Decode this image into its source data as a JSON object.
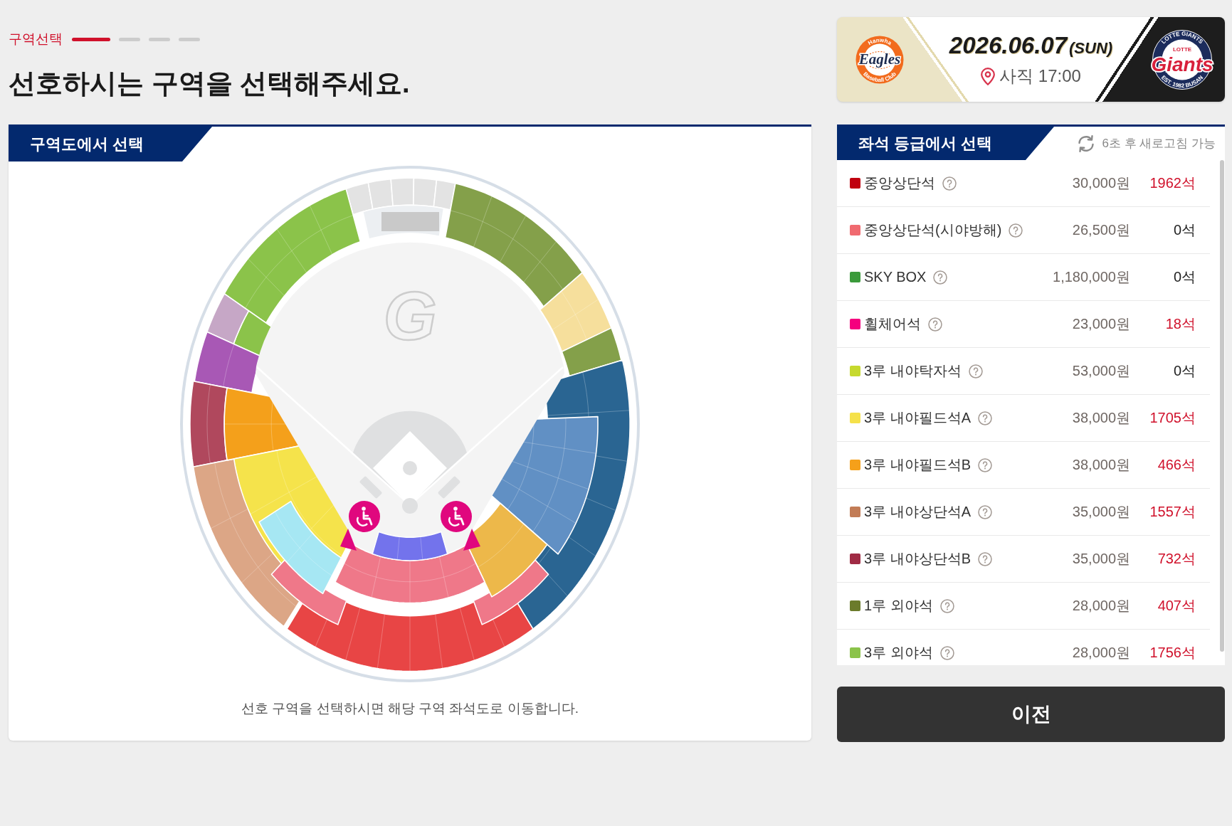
{
  "step_indicator": {
    "label": "구역선택",
    "steps": [
      {
        "active": true
      },
      {
        "active": false
      },
      {
        "active": false
      },
      {
        "active": false
      }
    ]
  },
  "page_title": "선호하시는 구역을 선택해주세요.",
  "map_panel": {
    "title": "구역도에서 선택",
    "field_logo": "G",
    "note": "선호 구역을 선택하시면 해당 구역 좌석도로 이동합니다."
  },
  "match": {
    "teams": [
      {
        "kind": "eagles",
        "wordmark": "Eagles",
        "ring_top": "Hanwha",
        "ring_bottom": "Baseball Club"
      },
      {
        "kind": "giants",
        "wordmark": "Giants",
        "badge": "LOTTE",
        "ring_top": "LOTTE GIANTS",
        "ring_bottom": "EST. 1982 BUSAN"
      }
    ],
    "date": "2026.06.07",
    "weekday": "(SUN)",
    "venue_time": "사직 17:00"
  },
  "grade_panel": {
    "title": "좌석 등급에서 선택",
    "refresh_note": "6초 후 새로고침 가능",
    "seat_grades": [
      {
        "name": "중앙상단석",
        "price": "30,000원",
        "count": "1962석",
        "available": true,
        "color": "#c0000f"
      },
      {
        "name": "중앙상단석(시야방해)",
        "price": "26,500원",
        "count": "0석",
        "available": false,
        "color": "#f06a70"
      },
      {
        "name": "SKY BOX",
        "price": "1,180,000원",
        "count": "0석",
        "available": false,
        "color": "#3b9a3b"
      },
      {
        "name": "휠체어석",
        "price": "23,000원",
        "count": "18석",
        "available": true,
        "color": "#f5007e"
      },
      {
        "name": "3루 내야탁자석",
        "price": "53,000원",
        "count": "0석",
        "available": false,
        "color": "#c6d92e"
      },
      {
        "name": "3루 내야필드석A",
        "price": "38,000원",
        "count": "1705석",
        "available": true,
        "color": "#f5e14a"
      },
      {
        "name": "3루 내야필드석B",
        "price": "38,000원",
        "count": "466석",
        "available": true,
        "color": "#f5a01a"
      },
      {
        "name": "3루 내야상단석A",
        "price": "35,000원",
        "count": "1557석",
        "available": true,
        "color": "#c27c56"
      },
      {
        "name": "3루 내야상단석B",
        "price": "35,000원",
        "count": "732석",
        "available": true,
        "color": "#a02b45"
      },
      {
        "name": "1루 외야석",
        "price": "28,000원",
        "count": "407석",
        "available": true,
        "color": "#6b7b2b"
      },
      {
        "name": "3루 외야석",
        "price": "28,000원",
        "count": "1756석",
        "available": true,
        "color": "#8bc34a"
      }
    ]
  },
  "prev_button": "이전"
}
